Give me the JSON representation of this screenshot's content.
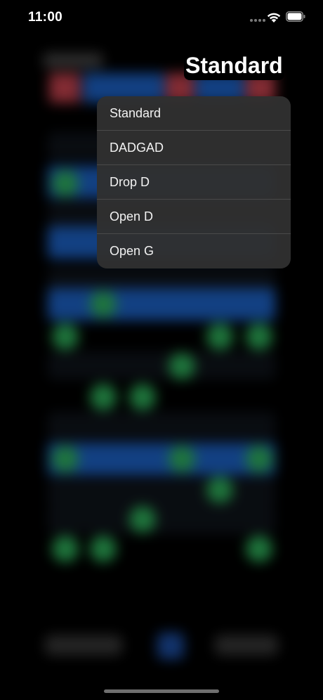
{
  "status_bar": {
    "time": "11:00"
  },
  "tuning": {
    "selected": "Standard"
  },
  "menu": {
    "items": [
      {
        "label": "Standard"
      },
      {
        "label": "DADGAD"
      },
      {
        "label": "Drop D"
      },
      {
        "label": "Open D"
      },
      {
        "label": "Open G"
      }
    ]
  },
  "colors": {
    "accent_blue": "#1d63c8",
    "note_green": "#2fb35c",
    "string_red": "#c8434f",
    "menu_background": "#303030"
  }
}
